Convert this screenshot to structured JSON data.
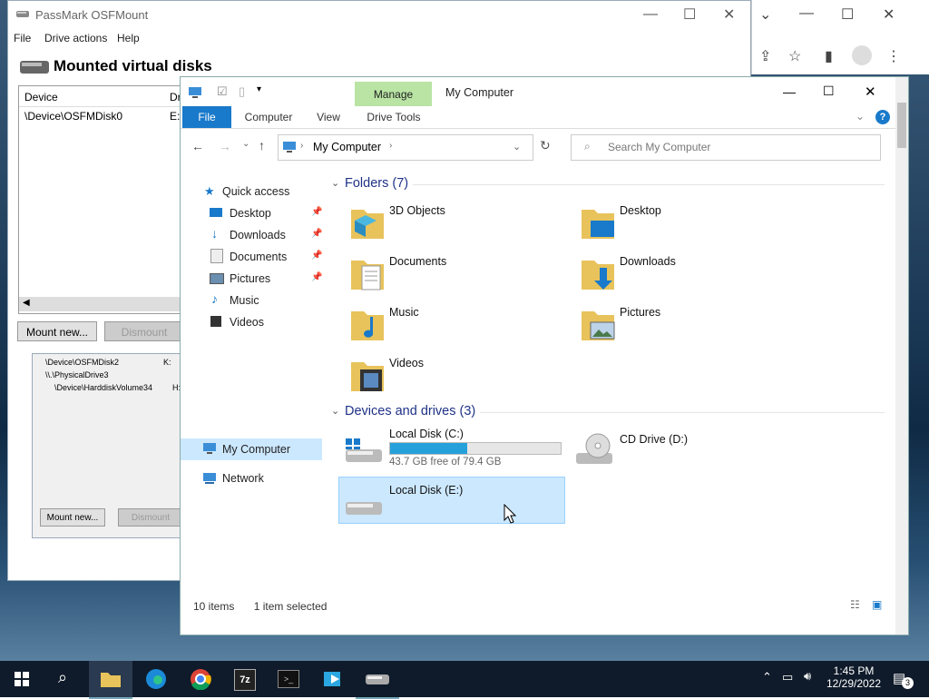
{
  "osfmount": {
    "title": "PassMark OSFMount",
    "menu": [
      "File",
      "Drive actions",
      "Help"
    ],
    "heading": "Mounted virtual disks",
    "columns": [
      "Device",
      "Dr"
    ],
    "rows": [
      {
        "device": "\\Device\\OSFMDisk0",
        "drive": "E:"
      }
    ],
    "mount_label": "Mount new...",
    "dismount_label": "Dismount",
    "inner_rows": [
      {
        "device": "\\Device\\OSFMDisk2",
        "drive": "K:"
      },
      {
        "device": "\\\\.\\PhysicalDrive3",
        "drive": ""
      },
      {
        "device": "\\Device\\HarddiskVolume34",
        "drive": "H:"
      }
    ],
    "inner_mount_label": "Mount new...",
    "inner_dismount_label": "Dismount"
  },
  "explorer": {
    "window_title": "My Computer",
    "manage_label": "Manage",
    "tabs": [
      "File",
      "Computer",
      "View",
      "Drive Tools"
    ],
    "address": "My Computer",
    "search_placeholder": "Search My Computer",
    "nav": {
      "quick_access": "Quick access",
      "items": [
        "Desktop",
        "Downloads",
        "Documents",
        "Pictures",
        "Music",
        "Videos"
      ],
      "my_computer": "My Computer",
      "network": "Network"
    },
    "folders_header": "Folders (7)",
    "folders": [
      "3D Objects",
      "Desktop",
      "Documents",
      "Downloads",
      "Music",
      "Pictures",
      "Videos"
    ],
    "drives_header": "Devices and drives (3)",
    "drives": [
      {
        "name": "Local Disk (C:)",
        "free": "43.7 GB free of 79.4 GB",
        "used_fraction": 0.45
      },
      {
        "name": "CD Drive (D:)"
      },
      {
        "name": "Local Disk (E:)"
      }
    ],
    "status_items": "10 items",
    "status_selected": "1 item selected"
  },
  "taskbar": {
    "time": "1:45 PM",
    "date": "12/29/2022",
    "notification_count": "3"
  },
  "colors": {
    "accent": "#1979ca",
    "selection": "#cce8ff",
    "manage": "#b9e4a4",
    "taskbar": "#0f1b2a"
  }
}
